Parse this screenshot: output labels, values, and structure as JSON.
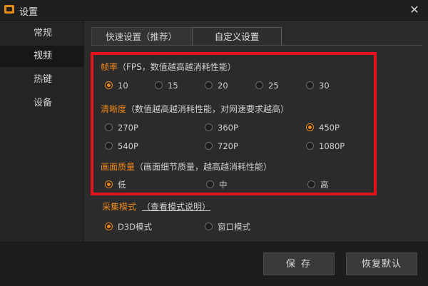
{
  "window": {
    "title": "设置",
    "close_glyph": "✕"
  },
  "sidebar": {
    "items": [
      {
        "label": "常规"
      },
      {
        "label": "视频"
      },
      {
        "label": "热键"
      },
      {
        "label": "设备"
      }
    ]
  },
  "tabs": [
    {
      "label": "快速设置（推荐）"
    },
    {
      "label": "自定义设置"
    }
  ],
  "frame_rate": {
    "title": "帧率",
    "hint": "（FPS，数值越高越消耗性能）",
    "options": [
      "10",
      "15",
      "20",
      "25",
      "30"
    ],
    "selected": "10"
  },
  "resolution": {
    "title": "清晰度",
    "hint": "（数值越高越消耗性能，对网速要求越高）",
    "options": [
      "270P",
      "360P",
      "450P",
      "540P",
      "720P",
      "1080P"
    ],
    "selected": "450P"
  },
  "quality": {
    "title": "画面质量",
    "hint": "（画面细节质量，越高越消耗性能）",
    "options": [
      "低",
      "中",
      "高"
    ],
    "selected": "低"
  },
  "capture_mode": {
    "title": "采集模式",
    "link": "（查看模式说明）",
    "options": [
      "D3D模式",
      "窗口模式"
    ],
    "selected": "D3D模式"
  },
  "footer": {
    "save_label": "保 存",
    "reset_label": "恢复默认"
  },
  "colors": {
    "accent": "#f08a1c",
    "highlight_frame": "#e3121b",
    "background": "#2b2b2b"
  },
  "icons": {
    "app": "settings-app-icon",
    "close": "close-icon"
  }
}
